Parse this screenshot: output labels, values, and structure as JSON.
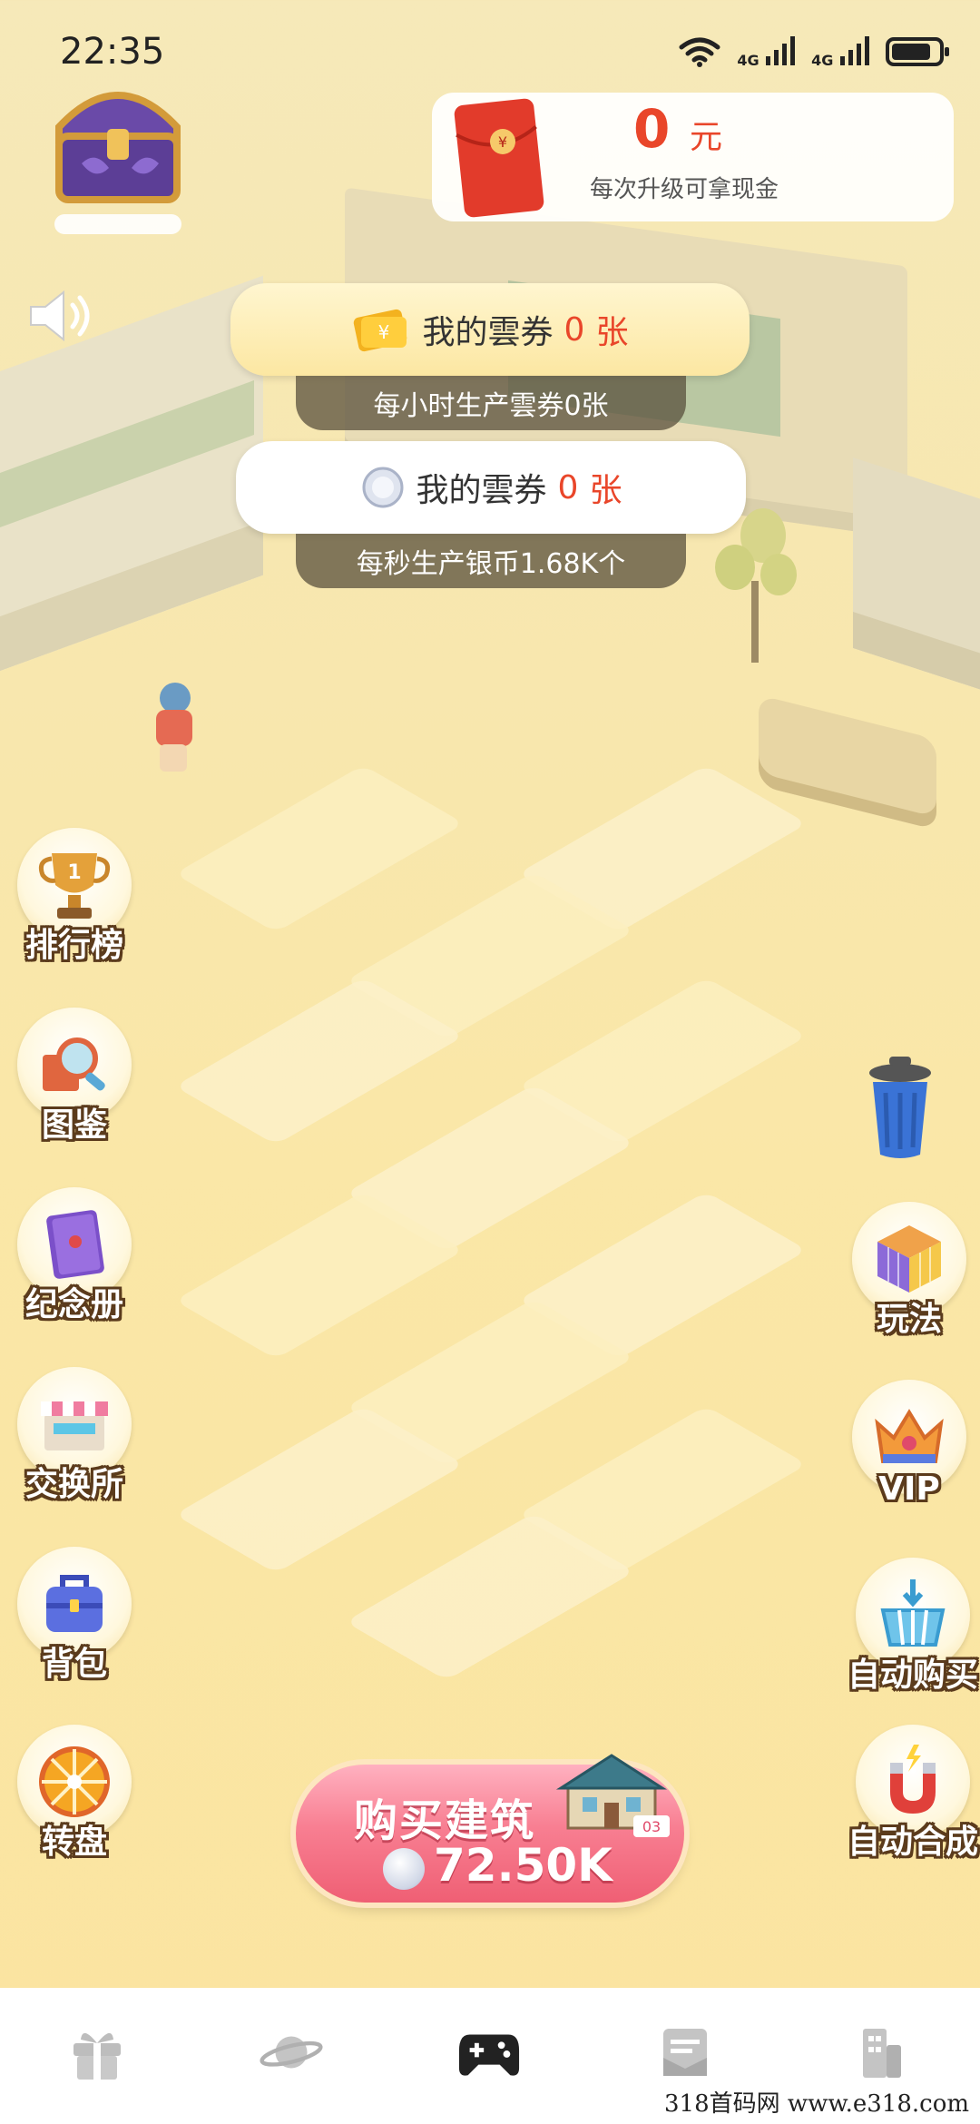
{
  "status_bar": {
    "time": "22:35",
    "network_1": "4G",
    "network_2": "4G"
  },
  "cash_card": {
    "amount": "0",
    "unit": "元",
    "tip": "每次升级可拿现金"
  },
  "coupons": {
    "label": "我的雲券",
    "count": "0",
    "unit": "张",
    "rate_text": "每小时生产雲券0张"
  },
  "silver": {
    "label": "我的雲券",
    "count": "0",
    "unit": "张",
    "rate_text": "每秒生产银币1.68K个"
  },
  "left_menu": [
    {
      "label": "排行榜",
      "icon": "trophy-icon"
    },
    {
      "label": "图鉴",
      "icon": "magnifier-icon"
    },
    {
      "label": "纪念册",
      "icon": "album-icon"
    },
    {
      "label": "交换所",
      "icon": "shop-icon"
    },
    {
      "label": "背包",
      "icon": "backpack-icon"
    },
    {
      "label": "转盘",
      "icon": "wheel-icon"
    }
  ],
  "right_menu": [
    {
      "label": "玩法",
      "icon": "rubiks-cube-icon"
    },
    {
      "label": "VIP",
      "icon": "crown-icon"
    },
    {
      "label": "自动购买",
      "icon": "basket-icon"
    },
    {
      "label": "自动合成",
      "icon": "magnet-icon"
    }
  ],
  "buy_button": {
    "title": "购买建筑",
    "price": "72.50K",
    "badge": "03"
  },
  "bottom_nav": [
    {
      "icon": "gift-icon"
    },
    {
      "icon": "planet-icon"
    },
    {
      "icon": "gamepad-icon",
      "active": true
    },
    {
      "icon": "mail-icon"
    },
    {
      "icon": "building-icon"
    }
  ],
  "watermark": "318首码网  www.e318.com",
  "colors": {
    "accent_red": "#e9462a",
    "button_pink": "#f87f92",
    "background": "#f7e7b0"
  }
}
